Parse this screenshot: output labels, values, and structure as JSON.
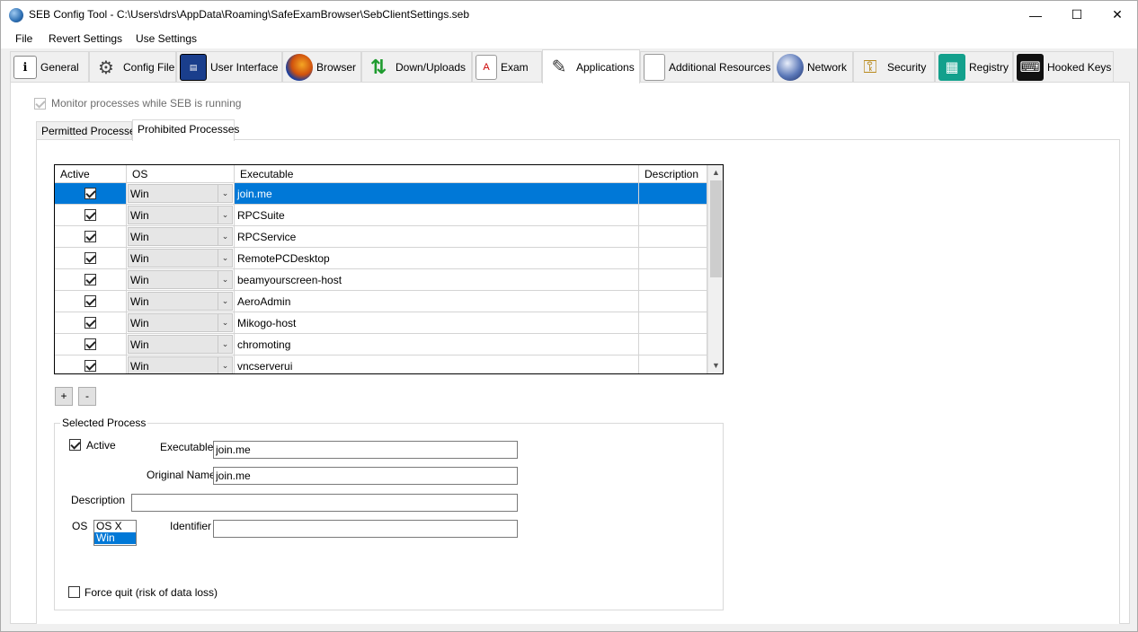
{
  "window": {
    "title": "SEB Config Tool - C:\\Users\\drs\\AppData\\Roaming\\SafeExamBrowser\\SebClientSettings.seb",
    "minimize": "—",
    "maximize": "☐",
    "close": "✕"
  },
  "menu": {
    "file": "File",
    "revert": "Revert Settings",
    "use": "Use Settings"
  },
  "tabs": [
    {
      "label": "General",
      "icon": "general-icon"
    },
    {
      "label": "Config File",
      "icon": "config-file-icon"
    },
    {
      "label": "User Interface",
      "icon": "user-interface-icon"
    },
    {
      "label": "Browser",
      "icon": "browser-icon"
    },
    {
      "label": "Down/Uploads",
      "icon": "down-uploads-icon"
    },
    {
      "label": "Exam",
      "icon": "exam-icon"
    },
    {
      "label": "Applications",
      "icon": "applications-icon"
    },
    {
      "label": "Additional Resources",
      "icon": "additional-resources-icon"
    },
    {
      "label": "Network",
      "icon": "network-icon"
    },
    {
      "label": "Security",
      "icon": "security-icon"
    },
    {
      "label": "Registry",
      "icon": "registry-icon"
    },
    {
      "label": "Hooked Keys",
      "icon": "hooked-keys-icon"
    }
  ],
  "active_tab": "Applications",
  "monitor_label": "Monitor processes while SEB is running",
  "subtabs": {
    "permitted": "Permitted Processes",
    "prohibited": "Prohibited Processes"
  },
  "table": {
    "headers": {
      "active": "Active",
      "os": "OS",
      "executable": "Executable",
      "description": "Description"
    },
    "rows": [
      {
        "active": true,
        "os": "Win",
        "executable": "join.me",
        "description": ""
      },
      {
        "active": true,
        "os": "Win",
        "executable": "RPCSuite",
        "description": ""
      },
      {
        "active": true,
        "os": "Win",
        "executable": "RPCService",
        "description": ""
      },
      {
        "active": true,
        "os": "Win",
        "executable": "RemotePCDesktop",
        "description": ""
      },
      {
        "active": true,
        "os": "Win",
        "executable": "beamyourscreen-host",
        "description": ""
      },
      {
        "active": true,
        "os": "Win",
        "executable": "AeroAdmin",
        "description": ""
      },
      {
        "active": true,
        "os": "Win",
        "executable": "Mikogo-host",
        "description": ""
      },
      {
        "active": true,
        "os": "Win",
        "executable": "chromoting",
        "description": ""
      },
      {
        "active": true,
        "os": "Win",
        "executable": "vncserverui",
        "description": ""
      }
    ]
  },
  "buttons": {
    "add": "+",
    "remove": "-"
  },
  "selected": {
    "legend": "Selected Process",
    "active_label": "Active",
    "executable_label": "Executable",
    "executable_value": "join.me",
    "original_name_label": "Original Name",
    "original_name_value": "join.me",
    "description_label": "Description",
    "description_value": "",
    "os_label": "OS",
    "os_options": [
      "OS X",
      "Win"
    ],
    "os_selected": "Win",
    "identifier_label": "Identifier",
    "identifier_value": "",
    "force_quit_label": "Force quit (risk of data loss)"
  }
}
